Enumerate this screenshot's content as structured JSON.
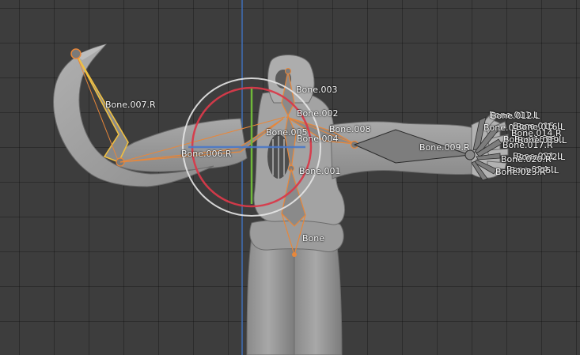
{
  "viewport": {
    "background": "#3d3d3d",
    "axis_colors": {
      "x": "#d83a4a",
      "y": "#6fb83a",
      "z": "#4a78c8",
      "view_z": "#3e6fb8"
    },
    "bone_color_selected": "#e8873a",
    "gizmo_colors": {
      "outer_circle": "#e6e6e6",
      "rotate_ring": "#d83a4a",
      "y_axis": "#6fb83a",
      "z_axis": "#4a78c8"
    }
  },
  "bones": [
    {
      "id": "bone",
      "label": "Bone"
    },
    {
      "id": "bone-001",
      "label": "Bone.001"
    },
    {
      "id": "bone-002",
      "label": "Bone.002"
    },
    {
      "id": "bone-003",
      "label": "Bone.003"
    },
    {
      "id": "bone-004",
      "label": "Bone.004"
    },
    {
      "id": "bone-005",
      "label": "Bone.005"
    },
    {
      "id": "bone-006-r",
      "label": "Bone.006.R"
    },
    {
      "id": "bone-007-r",
      "label": "Bone.007.R"
    },
    {
      "id": "bone-008",
      "label": "Bone.008"
    },
    {
      "id": "bone-009-r",
      "label": "Bone.009.R"
    },
    {
      "id": "bone-010-r",
      "label": "Bone.010.R"
    },
    {
      "id": "bone-011-l",
      "label": "Bone.011.L"
    },
    {
      "id": "bone-012-l",
      "label": "Bone.012.L"
    },
    {
      "id": "bone-013-r",
      "label": "Bone.013.R"
    },
    {
      "id": "bone-014-r",
      "label": "Bone.014.R"
    },
    {
      "id": "bone-015-l",
      "label": "Bone.015.L"
    },
    {
      "id": "bone-016-l",
      "label": "Bone.016.L"
    },
    {
      "id": "bone-017-r",
      "label": "Bone.017.R"
    },
    {
      "id": "bone-018-l",
      "label": "Bone.018.L"
    },
    {
      "id": "bone-019-l",
      "label": "Bone.019.L"
    },
    {
      "id": "bone-020-r",
      "label": "Bone.020.R"
    },
    {
      "id": "bone-021-l",
      "label": "Bone.021.L"
    },
    {
      "id": "bone-022-l",
      "label": "Bone.022.L"
    },
    {
      "id": "bone-023-r",
      "label": "Bone.023.R"
    },
    {
      "id": "bone-024-l",
      "label": "Bone.024.L"
    },
    {
      "id": "bone-025-l",
      "label": "Bone.025.L"
    }
  ]
}
